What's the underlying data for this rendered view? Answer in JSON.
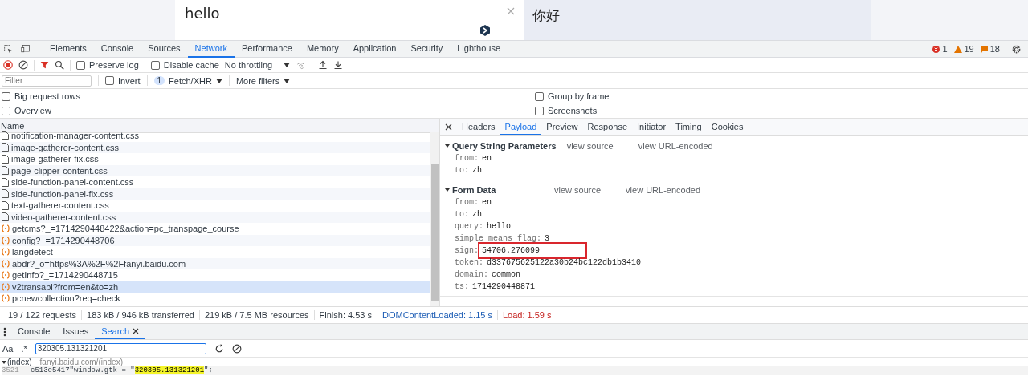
{
  "page": {
    "source_text": "hello",
    "target_text": "你好"
  },
  "devtools": {
    "tabs": [
      {
        "label": "Elements",
        "selected": false
      },
      {
        "label": "Console",
        "selected": false
      },
      {
        "label": "Sources",
        "selected": false
      },
      {
        "label": "Network",
        "selected": true
      },
      {
        "label": "Performance",
        "selected": false
      },
      {
        "label": "Memory",
        "selected": false
      },
      {
        "label": "Application",
        "selected": false
      },
      {
        "label": "Security",
        "selected": false
      },
      {
        "label": "Lighthouse",
        "selected": false
      }
    ],
    "counters": {
      "errors": "1",
      "warnings": "19",
      "issues": "18"
    },
    "toolbar": {
      "preserve_log": {
        "label": "Preserve log",
        "checked": false
      },
      "disable_cache": {
        "label": "Disable cache",
        "checked": false
      },
      "throttling": "No throttling"
    },
    "filter_bar": {
      "placeholder": "Filter",
      "invert": {
        "label": "Invert",
        "checked": false
      },
      "type_count": "1",
      "type_filter": "Fetch/XHR",
      "more_filters": "More filters"
    },
    "options": [
      {
        "label": "Big request rows",
        "checked": false
      },
      {
        "label": "Group by frame",
        "checked": false
      },
      {
        "label": "Overview",
        "checked": false
      },
      {
        "label": "Screenshots",
        "checked": false
      }
    ],
    "requests": {
      "column": "Name",
      "rows": [
        {
          "name": "notification-manager-content.css",
          "kind": "doc",
          "selected": false
        },
        {
          "name": "image-gatherer-content.css",
          "kind": "doc",
          "selected": false
        },
        {
          "name": "image-gatherer-fix.css",
          "kind": "doc",
          "selected": false
        },
        {
          "name": "page-clipper-content.css",
          "kind": "doc",
          "selected": false
        },
        {
          "name": "side-function-panel-content.css",
          "kind": "doc",
          "selected": false
        },
        {
          "name": "side-function-panel-fix.css",
          "kind": "doc",
          "selected": false
        },
        {
          "name": "text-gatherer-content.css",
          "kind": "doc",
          "selected": false
        },
        {
          "name": "video-gatherer-content.css",
          "kind": "doc",
          "selected": false
        },
        {
          "name": "getcms?_=1714290448422&action=pc_transpage_course",
          "kind": "xhr",
          "selected": false
        },
        {
          "name": "config?_=1714290448706",
          "kind": "xhr",
          "selected": false
        },
        {
          "name": "langdetect",
          "kind": "xhr",
          "selected": false
        },
        {
          "name": "abdr?_o=https%3A%2F%2Ffanyi.baidu.com",
          "kind": "xhr",
          "selected": false
        },
        {
          "name": "getInfo?_=1714290448715",
          "kind": "xhr",
          "selected": false
        },
        {
          "name": "v2transapi?from=en&to=zh",
          "kind": "xhr",
          "selected": true
        },
        {
          "name": "pcnewcollection?req=check",
          "kind": "xhr",
          "selected": false
        }
      ]
    },
    "detail_tabs": [
      {
        "label": "Headers",
        "selected": false
      },
      {
        "label": "Payload",
        "selected": true
      },
      {
        "label": "Preview",
        "selected": false
      },
      {
        "label": "Response",
        "selected": false
      },
      {
        "label": "Initiator",
        "selected": false
      },
      {
        "label": "Timing",
        "selected": false
      },
      {
        "label": "Cookies",
        "selected": false
      }
    ],
    "payload": [
      {
        "title": "Query String Parameters",
        "expanded": true,
        "links": [
          "view source",
          "view URL-encoded"
        ],
        "params": [
          {
            "key": "from:",
            "value": "en",
            "highlighted": false
          },
          {
            "key": "to:",
            "value": "zh",
            "highlighted": false
          }
        ]
      },
      {
        "title": "Form Data",
        "expanded": true,
        "links": [
          "view source",
          "view URL-encoded"
        ],
        "params": [
          {
            "key": "from:",
            "value": "en",
            "highlighted": false
          },
          {
            "key": "to:",
            "value": "zh",
            "highlighted": false
          },
          {
            "key": "query:",
            "value": "hello",
            "highlighted": false
          },
          {
            "key": "simple_means_flag:",
            "value": "3",
            "highlighted": false
          },
          {
            "key": "sign:",
            "value": "54706.276099",
            "highlighted": true
          },
          {
            "key": "token:",
            "value": "d337675625122a30b24bc122db1b3410",
            "highlighted": false
          },
          {
            "key": "domain:",
            "value": "common",
            "highlighted": false
          },
          {
            "key": "ts:",
            "value": "1714290448871",
            "highlighted": false
          }
        ]
      }
    ],
    "status_bar": [
      {
        "text": "19 / 122 requests",
        "kind": "plain"
      },
      {
        "text": "183 kB / 946 kB transferred",
        "kind": "plain"
      },
      {
        "text": "219 kB / 7.5 MB resources",
        "kind": "plain"
      },
      {
        "text": "Finish: 4.53 s",
        "kind": "plain"
      },
      {
        "text": "DOMContentLoaded: 1.15 s",
        "kind": "dom"
      },
      {
        "text": "Load: 1.59 s",
        "kind": "load"
      }
    ],
    "drawer": {
      "tabs": [
        {
          "label": "Console",
          "selected": false,
          "closable": false
        },
        {
          "label": "Issues",
          "selected": false,
          "closable": false
        },
        {
          "label": "Search",
          "selected": true,
          "closable": true
        }
      ],
      "case_toggle": "Aa",
      "regex_toggle": ".*",
      "query": "320305.131321201",
      "results": [
        {
          "file": "(index)",
          "url": "fanyi.baidu.com/(index)",
          "expanded": true,
          "lines": [
            {
              "number": "3521",
              "before": "c513e5417\"window.gtk = \"",
              "match": "320305.131321201",
              "after": "\";"
            }
          ]
        }
      ]
    }
  }
}
